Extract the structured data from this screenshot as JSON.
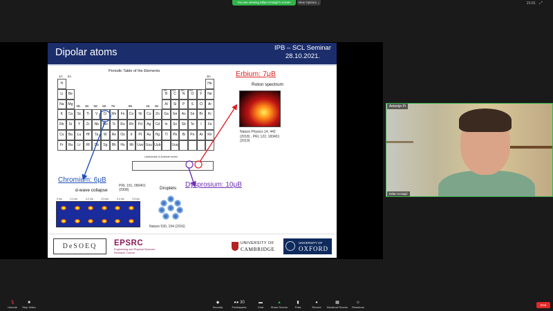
{
  "top_bar": {
    "share_banner": "You are viewing Milan Krstajić's screen",
    "view_options": "View Options ⌄",
    "time": "21:01"
  },
  "slide": {
    "title": "Dipolar atoms",
    "seminar_line1": "IPB – SCL Seminar",
    "seminar_line2": "28.10.2021.",
    "periodic_table_title": "Periodic Table of the Elements",
    "group_labels": [
      "1A",
      "2A",
      "3B",
      "4B",
      "5B",
      "6B",
      "7B",
      "8B",
      "1B",
      "2B",
      "3A",
      "4A",
      "5A",
      "6A",
      "7A",
      "8A"
    ],
    "lanthanide_label": "Lanthanide & Actinide series",
    "erbium_label": "Erbium: 7μB",
    "roton_title": "Roton spectrum",
    "roton_ref": "Nature Physics 14, 442 (2018) , PRL 122, 183401 (2019)",
    "chromium_label": "Chromium: 6μB",
    "dwave_title": "d-wave collapse",
    "dwave_ref": "PRL 101, 080401 (2008)",
    "dwave_times": [
      "0 ms",
      "0.1 ms",
      "0.2 ms",
      "0.3 ms",
      "0.4 ms",
      "0.5 ms"
    ],
    "droplets_title": "Droplets",
    "droplets_ref": "Nature 530, 194 (2016)",
    "dysprosium_label": "Dysprosium: 10μB",
    "logos": {
      "desoeq": "DeSOEQ",
      "epsrc": "EPSRC",
      "epsrc_sub": "Engineering and Physical Sciences Research Council",
      "cambridge_line1": "UNIVERSITY OF",
      "cambridge_line2": "CAMBRIDGE",
      "oxford_line1": "UNIVERSITY OF",
      "oxford_line2": "OXFORD"
    }
  },
  "video_tile": {
    "name_top": "Antonije Pi",
    "name_bottom": "Milan Krstajić"
  },
  "toolbar": {
    "unmute": "Unmute",
    "stop_video": "Stop Video",
    "security": "Security",
    "participants": "Participants",
    "participants_count": "30",
    "chat": "Chat",
    "share_screen": "Share Screen",
    "polls": "Polls",
    "record": "Record",
    "breakout": "Breakout Rooms",
    "reactions": "Reactions",
    "end": "End"
  },
  "colors": {
    "slide_header": "#1b2d6b",
    "erbium": "#dd2222",
    "chromium": "#1e4fb4",
    "dysprosium": "#6a2db0",
    "share_green": "#2fb34a",
    "end_red": "#e02828"
  }
}
